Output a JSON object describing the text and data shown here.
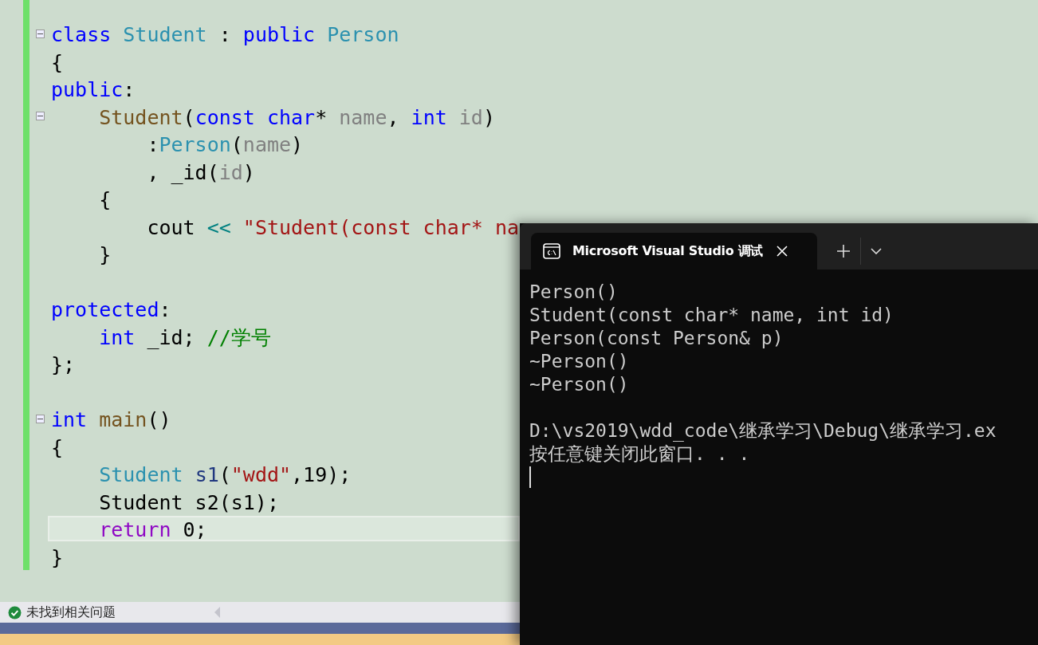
{
  "editor": {
    "lines": [
      {
        "fold": true,
        "current": false,
        "tokens": [
          {
            "kind": "keyword",
            "text": "class "
          },
          {
            "kind": "type",
            "text": "Student"
          },
          {
            "kind": "plain",
            "text": " : "
          },
          {
            "kind": "keyword",
            "text": "public "
          },
          {
            "kind": "type",
            "text": "Person"
          }
        ]
      },
      {
        "fold": false,
        "current": false,
        "tokens": [
          {
            "kind": "plain",
            "text": "{"
          }
        ]
      },
      {
        "fold": false,
        "current": false,
        "tokens": [
          {
            "kind": "keyword",
            "text": "public"
          },
          {
            "kind": "plain",
            "text": ":"
          }
        ]
      },
      {
        "fold": true,
        "current": false,
        "tokens": [
          {
            "kind": "function",
            "text": "    Student"
          },
          {
            "kind": "plain",
            "text": "("
          },
          {
            "kind": "keyword",
            "text": "const char"
          },
          {
            "kind": "plain",
            "text": "* "
          },
          {
            "kind": "param",
            "text": "name"
          },
          {
            "kind": "plain",
            "text": ", "
          },
          {
            "kind": "keyword",
            "text": "int "
          },
          {
            "kind": "param",
            "text": "id"
          },
          {
            "kind": "plain",
            "text": ")"
          }
        ]
      },
      {
        "fold": false,
        "current": false,
        "tokens": [
          {
            "kind": "plain",
            "text": "        :"
          },
          {
            "kind": "type",
            "text": "Person"
          },
          {
            "kind": "plain",
            "text": "("
          },
          {
            "kind": "param",
            "text": "name"
          },
          {
            "kind": "plain",
            "text": ")"
          }
        ]
      },
      {
        "fold": false,
        "current": false,
        "tokens": [
          {
            "kind": "plain",
            "text": "        , _id("
          },
          {
            "kind": "param",
            "text": "id"
          },
          {
            "kind": "plain",
            "text": ")"
          }
        ]
      },
      {
        "fold": false,
        "current": false,
        "tokens": [
          {
            "kind": "plain",
            "text": "    {"
          }
        ]
      },
      {
        "fold": false,
        "current": false,
        "tokens": [
          {
            "kind": "plain",
            "text": "        cout "
          },
          {
            "kind": "operator",
            "text": "<< "
          },
          {
            "kind": "string",
            "text": "\"Student(const char* na"
          }
        ]
      },
      {
        "fold": false,
        "current": false,
        "tokens": [
          {
            "kind": "plain",
            "text": "    }"
          }
        ]
      },
      {
        "fold": false,
        "current": false
      },
      {
        "fold": false,
        "current": false,
        "tokens": [
          {
            "kind": "keyword",
            "text": "protected"
          },
          {
            "kind": "plain",
            "text": ":"
          }
        ]
      },
      {
        "fold": false,
        "current": false,
        "tokens": [
          {
            "kind": "keyword",
            "text": "    int"
          },
          {
            "kind": "plain",
            "text": " _id; "
          },
          {
            "kind": "comment",
            "text": "//学号"
          }
        ]
      },
      {
        "fold": false,
        "current": false,
        "tokens": [
          {
            "kind": "plain",
            "text": "};"
          }
        ]
      },
      {
        "fold": false,
        "current": false
      },
      {
        "fold": true,
        "current": false,
        "tokens": [
          {
            "kind": "keyword",
            "text": "int "
          },
          {
            "kind": "function",
            "text": "main"
          },
          {
            "kind": "plain",
            "text": "()"
          }
        ]
      },
      {
        "fold": false,
        "current": false,
        "tokens": [
          {
            "kind": "plain",
            "text": "{"
          }
        ]
      },
      {
        "fold": false,
        "current": false,
        "tokens": [
          {
            "kind": "type",
            "text": "    Student "
          },
          {
            "kind": "local",
            "text": "s1"
          },
          {
            "kind": "plain",
            "text": "("
          },
          {
            "kind": "string",
            "text": "\"wdd\""
          },
          {
            "kind": "plain",
            "text": ",19);"
          }
        ]
      },
      {
        "fold": false,
        "current": false,
        "tokens": [
          {
            "kind": "plain",
            "text": "    Student s2(s1);"
          }
        ]
      },
      {
        "fold": false,
        "current": true,
        "tokens": [
          {
            "kind": "control",
            "text": "    return"
          },
          {
            "kind": "plain",
            "text": " 0;"
          }
        ]
      },
      {
        "fold": false,
        "current": false,
        "tokens": [
          {
            "kind": "plain",
            "text": "}"
          }
        ]
      }
    ]
  },
  "status_bar": {
    "message": "未找到相关问题"
  },
  "terminal": {
    "tab_title": "Microsoft Visual Studio 调试",
    "lines": [
      {
        "kind": "text",
        "text": "Person()"
      },
      {
        "kind": "text",
        "text": "Student(const char* name, int id)"
      },
      {
        "kind": "text",
        "text": "Person(const Person& p)"
      },
      {
        "kind": "text",
        "text": "~Person()"
      },
      {
        "kind": "text",
        "text": "~Person()"
      },
      {
        "kind": "blank"
      },
      {
        "kind": "text",
        "text": "D:\\vs2019\\wdd_code\\继承学习\\Debug\\继承学习.ex"
      },
      {
        "kind": "text",
        "text": "按任意键关闭此窗口. . ."
      },
      {
        "kind": "cursor"
      }
    ]
  }
}
